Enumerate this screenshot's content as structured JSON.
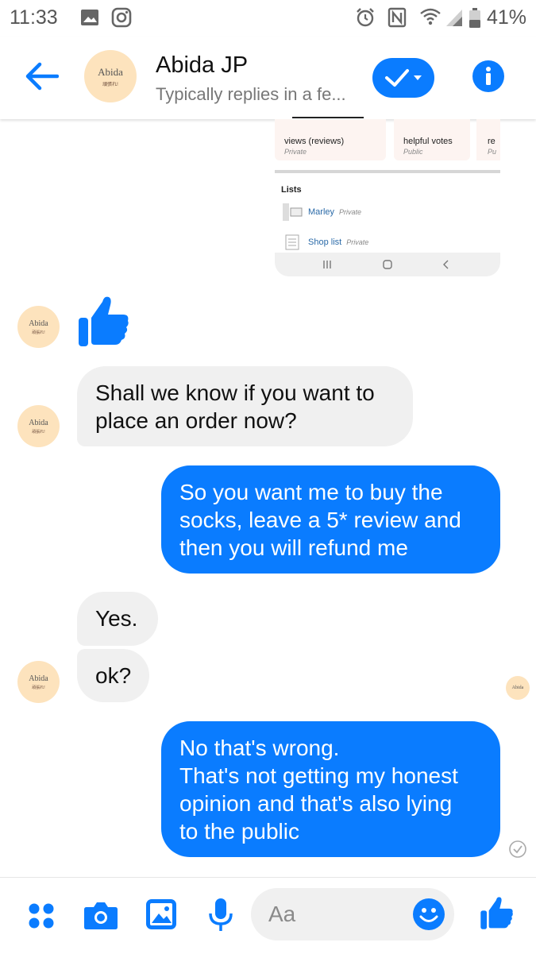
{
  "status_bar": {
    "time": "11:33",
    "battery": "41%",
    "icons": [
      "image-icon",
      "instagram-icon",
      "alarm-icon",
      "nfc-icon",
      "wifi-icon",
      "signal-icon",
      "battery-icon"
    ]
  },
  "header": {
    "contact_name": "Abida JP",
    "subtitle": "Typically replies in a fe...",
    "avatar_text": "Abida",
    "avatar_subtext": "頑張れ!"
  },
  "shared_screenshot": {
    "stats": [
      {
        "label": "views (reviews)",
        "privacy": "Private"
      },
      {
        "label": "helpful votes",
        "privacy": "Public"
      },
      {
        "label": "re",
        "privacy": "Pu"
      }
    ],
    "lists_heading": "Lists",
    "lists": [
      {
        "name": "Marley",
        "privacy": "Private"
      },
      {
        "name": "Shop list",
        "privacy": "Private"
      }
    ]
  },
  "messages": [
    {
      "from": "them",
      "text": "Shall we know if you want to\nplace an order now?"
    },
    {
      "from": "me",
      "text": "So you want me to buy the\nsocks, leave a 5* review and\nthen you will refund me"
    },
    {
      "from": "them",
      "text": "Yes."
    },
    {
      "from": "them",
      "text": "ok?"
    },
    {
      "from": "me",
      "text": "No that's wrong.\nThat's not getting my honest\nopinion and that's also lying\nto the public"
    }
  ],
  "composer": {
    "placeholder": "Aa"
  },
  "colors": {
    "accent": "#0a7cff",
    "incoming_bubble": "#f0f0f0",
    "avatar_bg": "#fde3bd"
  }
}
